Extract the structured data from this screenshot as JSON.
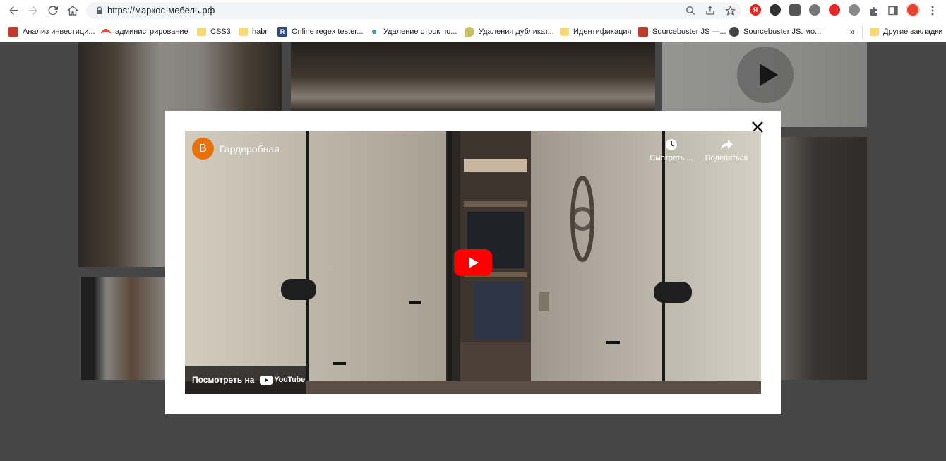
{
  "browser": {
    "url": "https://маркос-мебель.рф",
    "bookmarks": [
      {
        "label": "Анализ инвестици...",
        "icon": "chart-favicon"
      },
      {
        "label": "администрирование",
        "icon": "arc-favicon"
      },
      {
        "label": "CSS3",
        "icon": "folder-icon"
      },
      {
        "label": "habr",
        "icon": "folder-icon"
      },
      {
        "label": "Online regex tester...",
        "icon": "regex-favicon"
      },
      {
        "label": "Удаление строк по...",
        "icon": "nodes-favicon"
      },
      {
        "label": "Удаления дубликат...",
        "icon": "leaf-favicon"
      },
      {
        "label": "Идентификация",
        "icon": "folder-icon"
      },
      {
        "label": "Sourcebuster JS —...",
        "icon": "pdf-favicon"
      },
      {
        "label": "Sourcebuster JS: мо...",
        "icon": "github-favicon"
      }
    ],
    "more_bookmarks": "»",
    "other_bookmarks": "Другие закладки"
  },
  "video": {
    "channel_initial": "В",
    "title": "Гардеробная",
    "watch_later": "Смотреть ...",
    "share": "Поделиться",
    "watch_on": "Посмотреть на",
    "youtube": "YouTube"
  },
  "colors": {
    "youtube_red": "#ff0000",
    "avatar_orange": "#e8710a",
    "overlay": "#666666"
  }
}
